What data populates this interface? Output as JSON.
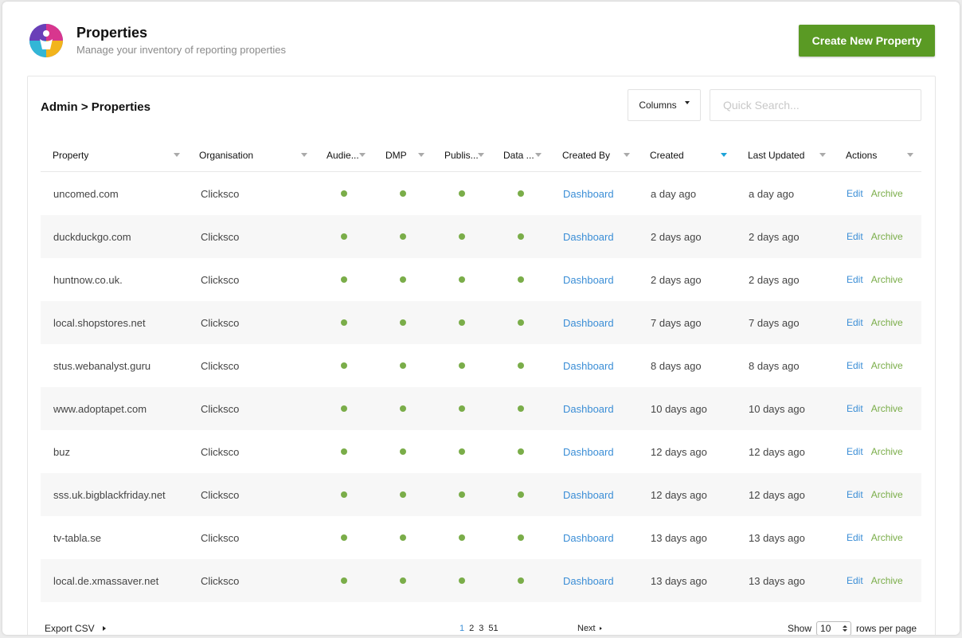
{
  "header": {
    "title": "Properties",
    "subtitle": "Manage your inventory of reporting properties",
    "create_button": "Create New Property",
    "logo_icon": "properties-logo-icon"
  },
  "toolbar": {
    "breadcrumb": "Admin > Properties",
    "columns_label": "Columns",
    "search_placeholder": "Quick Search..."
  },
  "table": {
    "columns": [
      {
        "key": "property",
        "label": "Property"
      },
      {
        "key": "organisation",
        "label": "Organisation"
      },
      {
        "key": "audience",
        "label": "Audie..."
      },
      {
        "key": "dmp",
        "label": "DMP"
      },
      {
        "key": "publisher",
        "label": "Publis..."
      },
      {
        "key": "data",
        "label": "Data ..."
      },
      {
        "key": "created_by",
        "label": "Created By"
      },
      {
        "key": "created",
        "label": "Created"
      },
      {
        "key": "last_updated",
        "label": "Last Updated"
      },
      {
        "key": "actions",
        "label": "Actions"
      }
    ],
    "sorted_column": "created",
    "rows": [
      {
        "property": "uncomed.com",
        "organisation": "Clicksco",
        "created_by": "Dashboard",
        "created": "a day ago",
        "last_updated": "a day ago"
      },
      {
        "property": "duckduckgo.com",
        "organisation": "Clicksco",
        "created_by": "Dashboard",
        "created": "2 days ago",
        "last_updated": "2 days ago"
      },
      {
        "property": "huntnow.co.uk.",
        "organisation": "Clicksco",
        "created_by": "Dashboard",
        "created": "2 days ago",
        "last_updated": "2 days ago"
      },
      {
        "property": "local.shopstores.net",
        "organisation": "Clicksco",
        "created_by": "Dashboard",
        "created": "7 days ago",
        "last_updated": "7 days ago"
      },
      {
        "property": "stus.webanalyst.guru",
        "organisation": "Clicksco",
        "created_by": "Dashboard",
        "created": "8 days ago",
        "last_updated": "8 days ago"
      },
      {
        "property": "www.adoptapet.com",
        "organisation": "Clicksco",
        "created_by": "Dashboard",
        "created": "10 days ago",
        "last_updated": "10 days ago"
      },
      {
        "property": "buz",
        "organisation": "Clicksco",
        "created_by": "Dashboard",
        "created": "12 days ago",
        "last_updated": "12 days ago"
      },
      {
        "property": "sss.uk.bigblackfriday.net",
        "organisation": "Clicksco",
        "created_by": "Dashboard",
        "created": "12 days ago",
        "last_updated": "12 days ago"
      },
      {
        "property": "tv-tabla.se",
        "organisation": "Clicksco",
        "created_by": "Dashboard",
        "created": "13 days ago",
        "last_updated": "13 days ago"
      },
      {
        "property": "local.de.xmassaver.net",
        "organisation": "Clicksco",
        "created_by": "Dashboard",
        "created": "13 days ago",
        "last_updated": "13 days ago"
      }
    ],
    "edit_label": "Edit",
    "archive_label": "Archive",
    "status_color": "#7aad49"
  },
  "footer": {
    "export_label": "Export CSV",
    "pages": [
      "1",
      "2",
      "3",
      "51"
    ],
    "current_page": "1",
    "next_label": "Next",
    "show_label": "Show",
    "rows_per_page_value": "10",
    "rows_per_page_label": "rows per page"
  },
  "colors": {
    "primary_button": "#5a9a24",
    "link": "#3b8ed6",
    "status_dot": "#7aad49",
    "sort_active": "#1ca3d8"
  }
}
